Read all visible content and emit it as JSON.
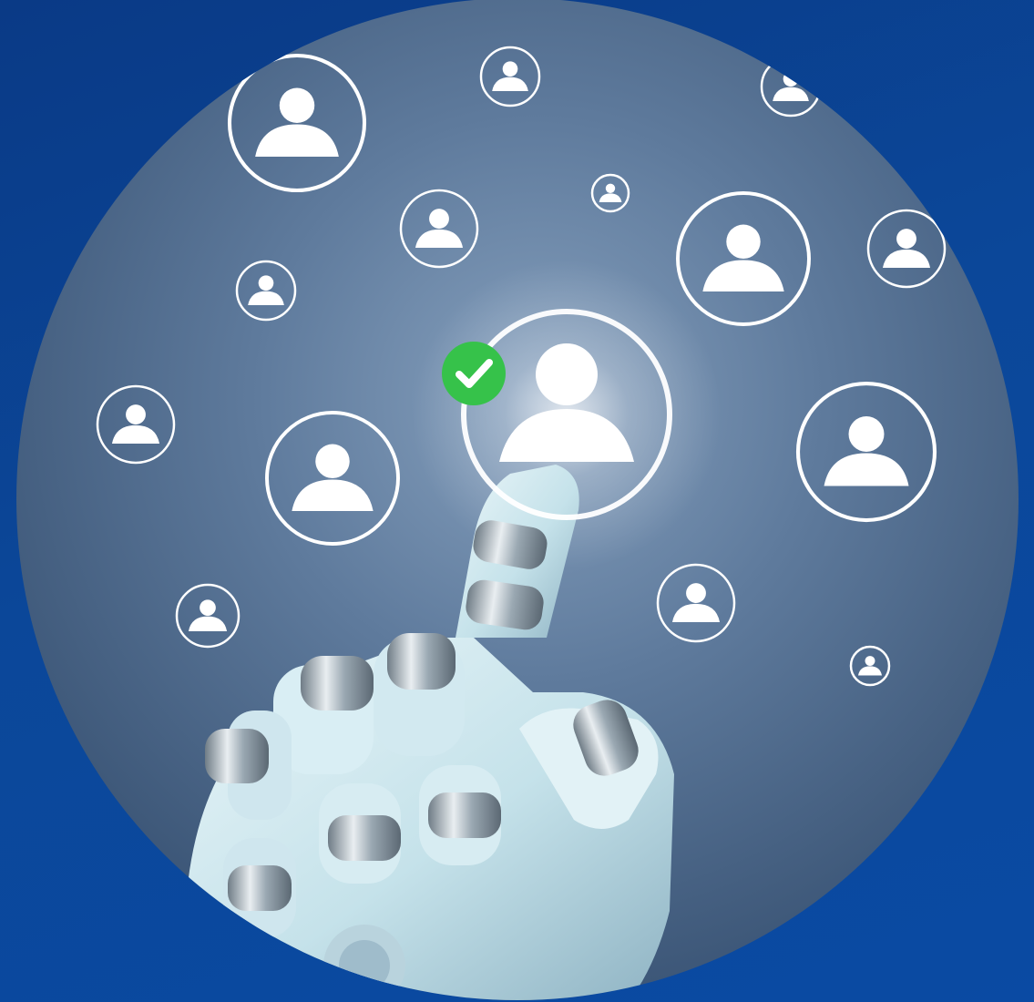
{
  "colors": {
    "background": "#0b4799",
    "disc_center": "#6f8aa9",
    "disc_edge": "#3c5779",
    "icon_stroke": "#ffffff",
    "check_badge": "#36c24a",
    "robot_light": "#dceef4",
    "robot_shade": "#8fb3c3",
    "robot_metal": "#aab6bf"
  },
  "icons": {
    "profile": "user-profile-icon",
    "selected": "selected-user-icon",
    "badge": "checkmark-icon",
    "hand": "robot-hand"
  },
  "selection": {
    "selected_count": 1,
    "state": "verified"
  }
}
